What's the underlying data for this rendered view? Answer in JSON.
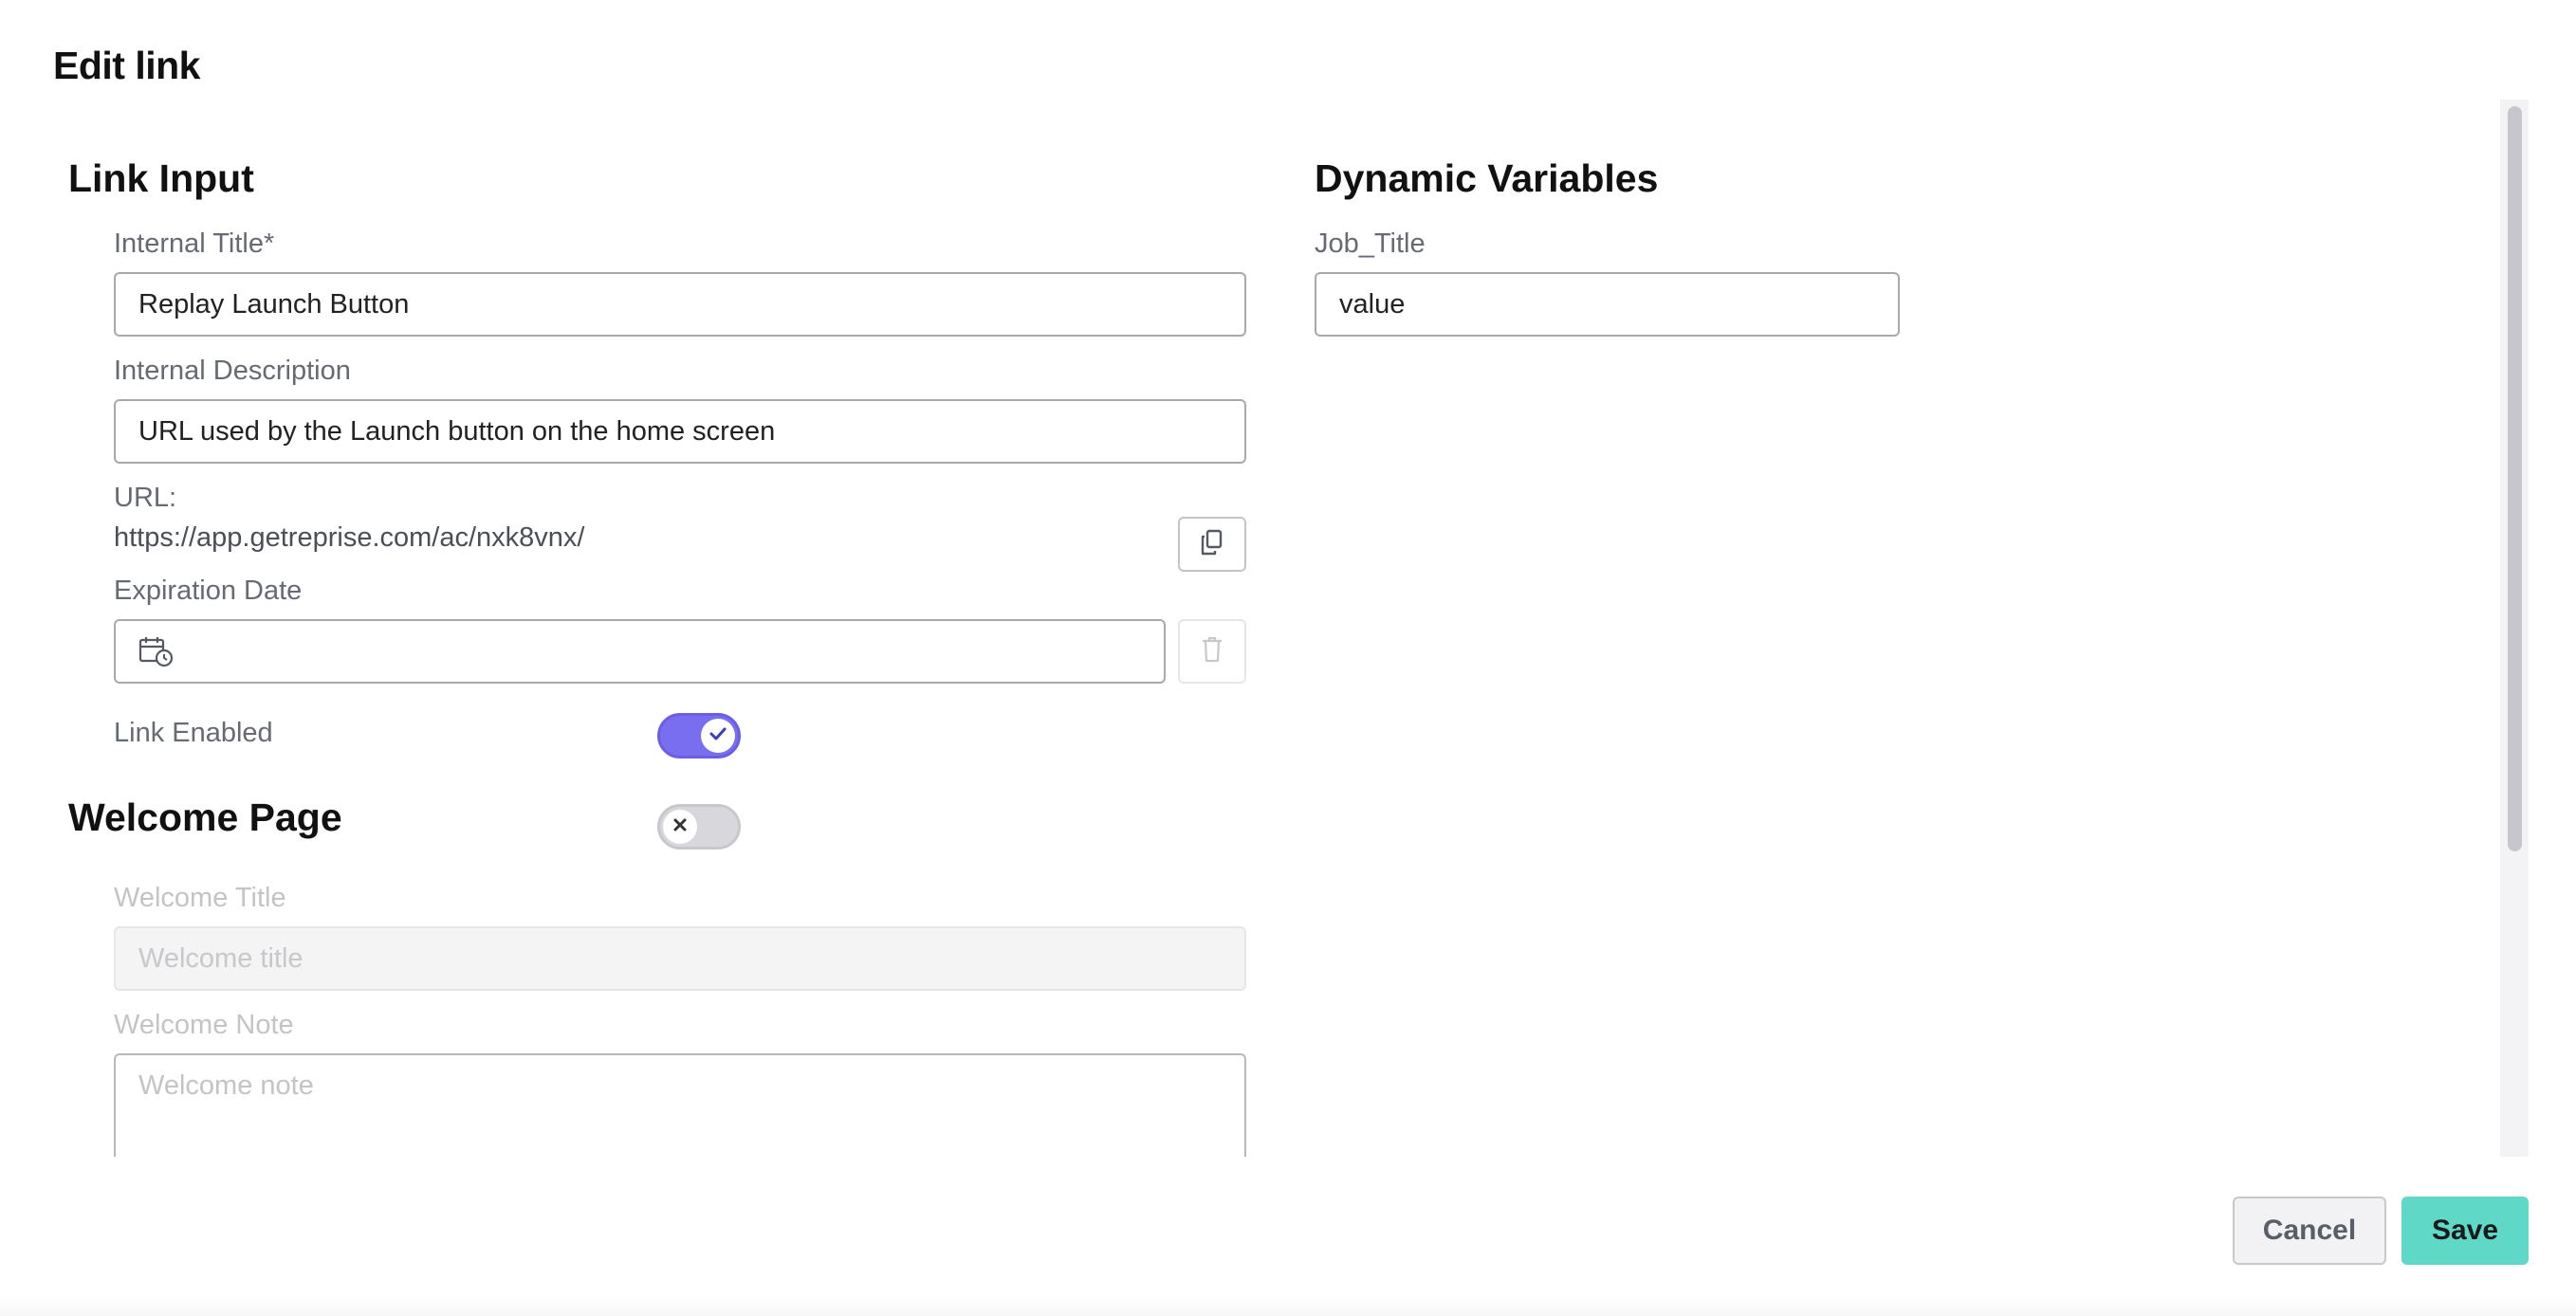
{
  "dialog": {
    "title": "Edit link"
  },
  "link_input": {
    "heading": "Link Input",
    "internal_title": {
      "label": "Internal Title*",
      "value": "Replay Launch Button"
    },
    "internal_description": {
      "label": "Internal Description",
      "value": "URL used by the Launch button on the home screen"
    },
    "url": {
      "label": "URL:",
      "value": "https://app.getreprise.com/ac/nxk8vnx/"
    },
    "expiration_date": {
      "label": "Expiration Date",
      "value": ""
    },
    "link_enabled": {
      "label": "Link Enabled",
      "enabled": true
    }
  },
  "welcome_page": {
    "heading": "Welcome Page",
    "enabled": false,
    "welcome_title": {
      "label": "Welcome Title",
      "placeholder": "Welcome title"
    },
    "welcome_note": {
      "label": "Welcome Note",
      "placeholder": "Welcome note"
    }
  },
  "dynamic_variables": {
    "heading": "Dynamic Variables",
    "variables": [
      {
        "name": "Job_Title",
        "value": "value"
      }
    ]
  },
  "footer": {
    "cancel_label": "Cancel",
    "save_label": "Save"
  },
  "colors": {
    "toggle_on": "#7a6ef0",
    "save_button": "#5fd8c8"
  },
  "icons": {
    "copy": "copy-icon",
    "calendar": "calendar-clock-icon",
    "delete": "trash-icon",
    "toggle_on": "check-icon",
    "toggle_off": "x-icon"
  }
}
